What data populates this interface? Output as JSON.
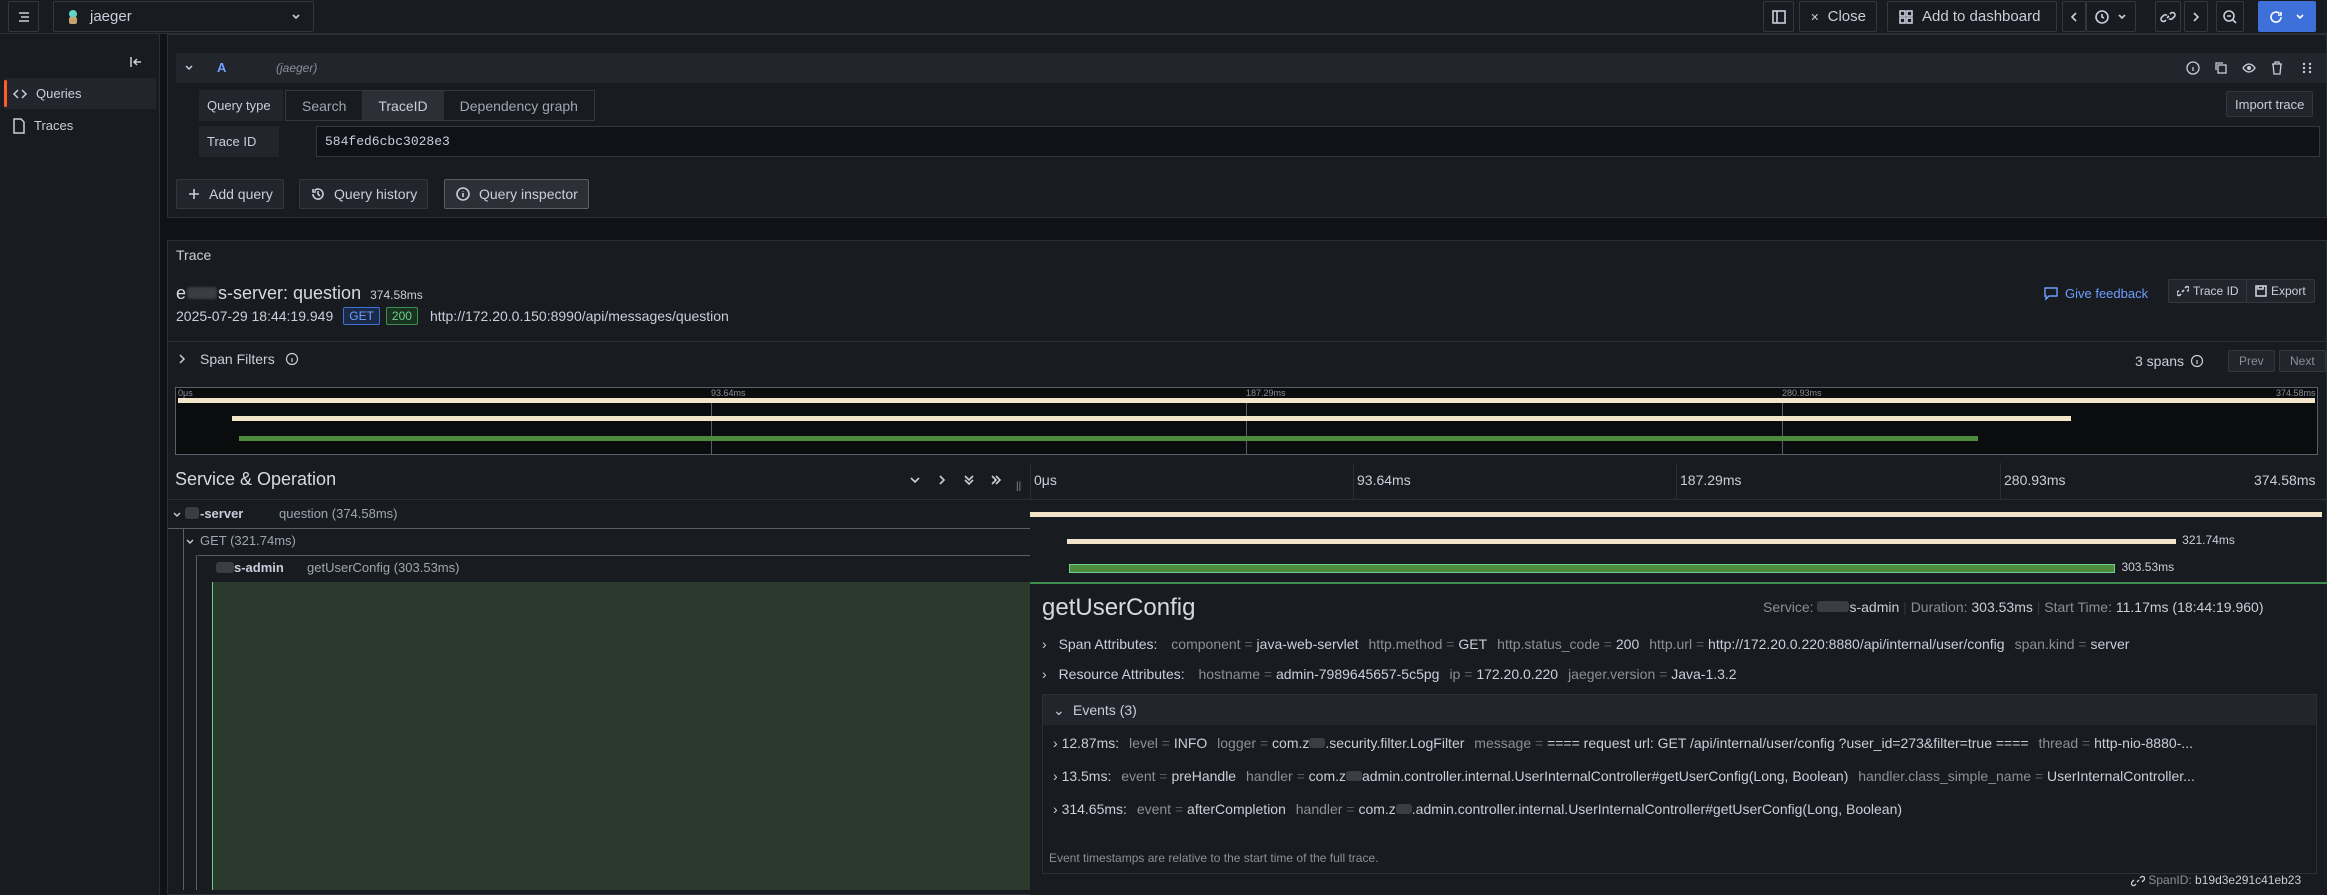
{
  "topbar": {
    "datasource": "jaeger",
    "close_label": "Close",
    "add_dashboard_label": "Add to dashboard"
  },
  "sidebar": {
    "items": [
      {
        "label": "Queries"
      },
      {
        "label": "Traces"
      }
    ]
  },
  "query": {
    "ref_id": "A",
    "ds_name": "(jaeger)",
    "query_type_label": "Query type",
    "types": [
      "Search",
      "TraceID",
      "Dependency graph"
    ],
    "selected_type": "TraceID",
    "import_trace_label": "Import trace",
    "trace_id_label": "Trace ID",
    "trace_id_value": "584fed6cbc3028e3",
    "add_query_label": "Add query",
    "query_history_label": "Query history",
    "query_inspector_label": "Query inspector"
  },
  "trace": {
    "panel_title": "Trace",
    "service_prefix": "e",
    "title": "s-server: question",
    "duration": "374.58ms",
    "timestamp": "2025-07-29 18:44:19.949",
    "method": "GET",
    "status": "200",
    "url": "http://172.20.0.150:8990/api/messages/question",
    "give_feedback_label": "Give feedback",
    "trace_id_btn": "Trace ID",
    "export_btn": "Export",
    "span_filters_label": "Span Filters",
    "span_count": "3 spans",
    "prev_label": "Prev",
    "next_label": "Next"
  },
  "minimap": {
    "ticks": [
      "0μs",
      "93.64ms",
      "187.29ms",
      "280.93ms",
      "374.58ms"
    ]
  },
  "timeline": {
    "header": "Service & Operation",
    "ticks": [
      "0μs",
      "93.64ms",
      "187.29ms",
      "280.93ms",
      "374.58ms"
    ],
    "spans": [
      {
        "service": "-server",
        "operation": "question (374.58ms)",
        "duration_label": "",
        "start": 0,
        "end": 374.58
      },
      {
        "service": "",
        "operation": "GET (321.74ms)",
        "duration_label": "321.74ms",
        "start": 10.6,
        "end": 332.3
      },
      {
        "service": "s-admin",
        "operation": "getUserConfig (303.53ms)",
        "duration_label": "303.53ms",
        "start": 11.17,
        "end": 314.7
      }
    ],
    "total_ms": 374.58
  },
  "detail": {
    "title": "getUserConfig",
    "service_label": "Service:",
    "service_value": "s-admin",
    "duration_label": "Duration:",
    "duration_value": "303.53ms",
    "start_label": "Start Time:",
    "start_value": "11.17ms (18:44:19.960)",
    "span_attr_label": "Span Attributes:",
    "span_attrs": [
      {
        "k": "component",
        "v": "java-web-servlet"
      },
      {
        "k": "http.method",
        "v": "GET"
      },
      {
        "k": "http.status_code",
        "v": "200"
      },
      {
        "k": "http.url",
        "v": "http://172.20.0.220:8880/api/internal/user/config"
      },
      {
        "k": "span.kind",
        "v": "server"
      }
    ],
    "resource_attr_label": "Resource Attributes:",
    "resource_attrs": [
      {
        "k": "hostname",
        "v": "admin-7989645657-5c5pg"
      },
      {
        "k": "ip",
        "v": "172.20.0.220"
      },
      {
        "k": "jaeger.version",
        "v": "Java-1.3.2"
      }
    ],
    "events_label": "Events (3)",
    "events": [
      {
        "time": "12.87ms:",
        "text1k": "level",
        "text1v": "INFO",
        "text2k": "logger",
        "text2v": "com.z",
        "text2v_rest": ".security.filter.LogFilter",
        "text3k": "message",
        "text3v": "==== request url: GET /api/internal/user/config ?user_id=273&filter=true ====",
        "text4k": "thread",
        "text4v": "http-nio-8880-..."
      },
      {
        "time": "13.5ms:",
        "text1k": "event",
        "text1v": "preHandle",
        "text2k": "handler",
        "text2v": "com.z",
        "text2v_rest": "admin.controller.internal.UserInternalController#getUserConfig(Long, Boolean)",
        "text3k": "handler.class_simple_name",
        "text3v": "UserInternalController..."
      },
      {
        "time": "314.65ms:",
        "text1k": "event",
        "text1v": "afterCompletion",
        "text2k": "handler",
        "text2v": "com.z",
        "text2v_rest": ".admin.controller.internal.UserInternalController#getUserConfig(Long, Boolean)"
      }
    ],
    "footnote": "Event timestamps are relative to the start time of the full trace.",
    "span_id_label": "SpanID:",
    "span_id_value": "b19d3e291c41eb23"
  }
}
